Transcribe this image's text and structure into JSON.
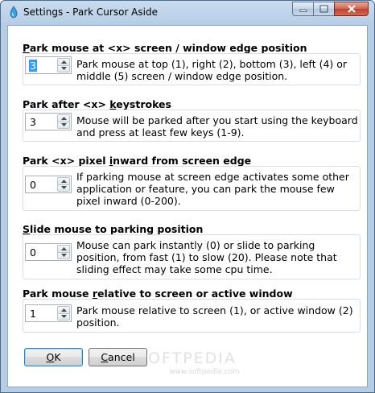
{
  "window": {
    "title": "Settings - Park Cursor Aside",
    "icon": "park-cursor-app-icon"
  },
  "groups": [
    {
      "title_pre": "",
      "title_u": "P",
      "title_post": "ark mouse at <x> screen / window edge position",
      "value": "3",
      "description": "Park mouse at top (1), right (2), bottom (3), left (4) or middle (5) screen / window edge position."
    },
    {
      "title_pre": "Park after <x> ",
      "title_u": "k",
      "title_post": "eystrokes",
      "value": "3",
      "description": "Mouse will be parked after you start using the keyboard and press at least few keys (1-9)."
    },
    {
      "title_pre": "Park <x> pixel ",
      "title_u": "i",
      "title_post": "nward from screen edge",
      "value": "0",
      "description": "If parking mouse at screen edge activates some other application or feature, you can park the mouse few pixel inward (0-200)."
    },
    {
      "title_pre": "",
      "title_u": "S",
      "title_post": "lide mouse to parking position",
      "value": "0",
      "description": "Mouse can park instantly (0) or slide to parking position, from fast (1) to slow (20). Please note that sliding effect may take some cpu time."
    },
    {
      "title_pre": "Park mouse ",
      "title_u": "r",
      "title_post": "elative to screen or active window",
      "value": "1",
      "description": "Park mouse relative to screen (1), or active window (2) position."
    }
  ],
  "buttons": {
    "ok_u": "O",
    "ok_rest": "K",
    "cancel_u": "C",
    "cancel_rest": "ancel"
  },
  "watermark": {
    "text": "SOFTPEDIA",
    "sub": "www.softpedia.com"
  }
}
